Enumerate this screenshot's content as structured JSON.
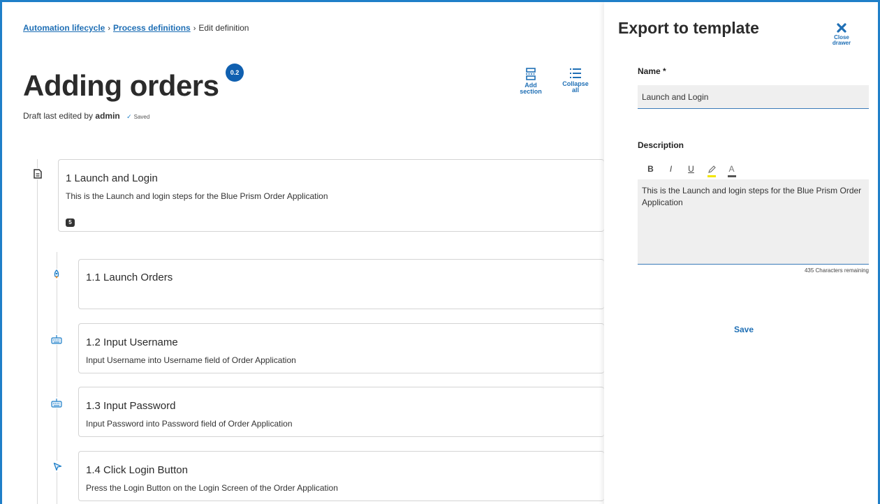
{
  "breadcrumb": {
    "items": [
      "Automation lifecycle",
      "Process definitions"
    ],
    "current": "Edit definition",
    "separator": "›"
  },
  "page": {
    "title": "Adding orders",
    "version": "0.2",
    "draft_prefix": "Draft last edited by",
    "draft_user": "admin",
    "saved_label": "Saved"
  },
  "toolbar": {
    "add_section_line1": "Add",
    "add_section_line2": "section",
    "collapse_line1": "Collapse",
    "collapse_line2": "all"
  },
  "sections": [
    {
      "title": "1 Launch and Login",
      "description": "This is the Launch and login steps for the Blue Prism Order Application",
      "count": "5",
      "icon": "document-icon"
    }
  ],
  "steps": [
    {
      "title": "1.1 Launch Orders",
      "description": "",
      "icon": "rocket-icon"
    },
    {
      "title": "1.2 Input Username",
      "description": "Input Username into Username field of Order Application",
      "icon": "keyboard-icon"
    },
    {
      "title": "1.3 Input Password",
      "description": "Input Password into Password field of Order Application",
      "icon": "keyboard-icon"
    },
    {
      "title": "1.4 Click Login Button",
      "description": "Press the Login Button on the Login Screen of the Order Application",
      "icon": "cursor-icon"
    }
  ],
  "drawer": {
    "title": "Export to template",
    "close_line1": "Close",
    "close_line2": "drawer",
    "name_label": "Name *",
    "name_value": "Launch and Login",
    "description_label": "Description",
    "format": {
      "bold": "B",
      "italic": "I",
      "underline": "U",
      "highlight": "",
      "font_color": "A"
    },
    "description_value": "This is the Launch and login steps for the Blue Prism Order Application",
    "chars_remaining": "435 Characters remaining",
    "save_label": "Save"
  },
  "colors": {
    "accent": "#1f6fb5",
    "badge": "#1060b0",
    "frame": "#1f7fc8",
    "highlight": "#f2e600"
  }
}
